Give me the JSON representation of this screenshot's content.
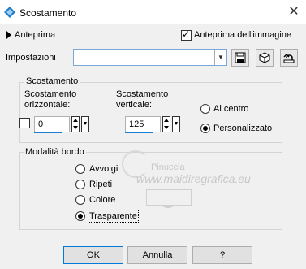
{
  "window": {
    "title": "Scostamento",
    "close_glyph": "✕"
  },
  "preview": {
    "label": "Anteprima",
    "image_preview_label": "Anteprima dell'immagine",
    "image_preview_checked": true
  },
  "settings": {
    "label": "Impostazioni",
    "preset_value": ""
  },
  "offset_group": {
    "title": "Scostamento",
    "horizontal": {
      "label_line1": "Scostamento",
      "label_line2": "orizzontale:",
      "value": "0"
    },
    "vertical": {
      "label_line1": "Scostamento",
      "label_line2": "verticale:",
      "value": "125"
    },
    "link_checked": false,
    "center_label": "Al centro",
    "custom_label": "Personalizzato",
    "selected": "custom"
  },
  "edge_group": {
    "title": "Modalità bordo",
    "options": [
      "Avvolgi",
      "Ripeti",
      "Colore",
      "Trasparente"
    ],
    "selected": "Trasparente"
  },
  "watermark": {
    "top": "Pinuccia",
    "main": "www.maidiregrafica.eu"
  },
  "buttons": {
    "ok": "OK",
    "cancel": "Annulla",
    "help": "?"
  },
  "icons": {
    "app": "offset-app-icon",
    "save": "save-icon",
    "reset": "cube-icon",
    "default": "undo-arrow-icon",
    "dropdown": "chevron-down-icon"
  },
  "colors": {
    "accent": "#1a7fd4",
    "select_border": "#7aa7d6",
    "default_button_border": "#0078d7"
  }
}
